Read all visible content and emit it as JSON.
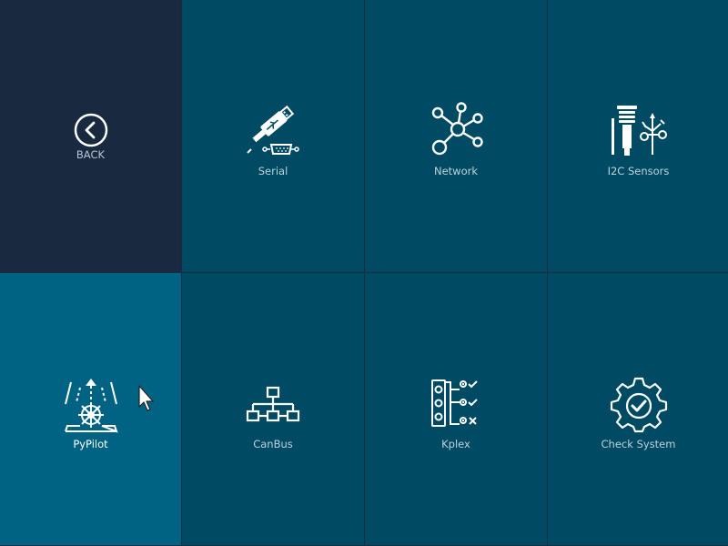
{
  "tiles": [
    {
      "label": "BACK",
      "icon": "back-arrow-icon"
    },
    {
      "label": "Serial",
      "icon": "usb-serial-icon"
    },
    {
      "label": "Network",
      "icon": "network-icon"
    },
    {
      "label": "I2C Sensors",
      "icon": "weather-sensor-icon"
    },
    {
      "label": "PyPilot",
      "icon": "autopilot-helm-icon"
    },
    {
      "label": "CanBus",
      "icon": "canbus-tree-icon"
    },
    {
      "label": "Kplex",
      "icon": "kplex-multiplexer-icon"
    },
    {
      "label": "Check System",
      "icon": "gear-check-icon"
    }
  ],
  "colors": {
    "tile": "#004a63",
    "tile_active": "#006383",
    "back_tile": "#19293f",
    "icon": "#ffffff",
    "label": "#bcd3dd"
  },
  "active_tile": "PyPilot"
}
